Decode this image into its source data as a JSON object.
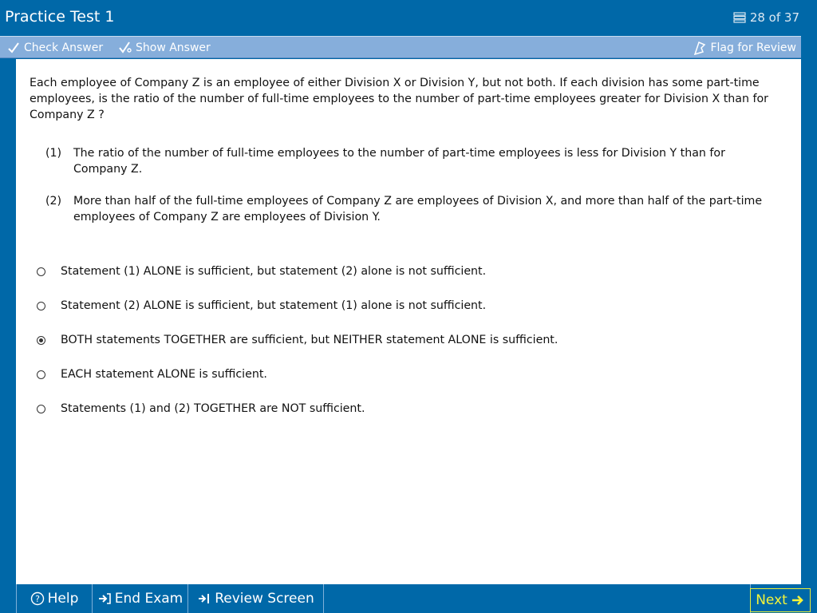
{
  "window": {
    "title": "Practice Test 1",
    "progress": "28 of 37",
    "progress_icon": "stack-icon"
  },
  "toolbar": {
    "check_answer": "Check Answer",
    "show_answer": "Show Answer",
    "flag_for_review": "Flag for Review"
  },
  "question": {
    "stem": "Each employee of Company Z is an employee of either Division X or Division Y, but not both.  If each division has some part-time employees, is the ratio of the number of full-time employees to the number of part-time employees greater for Division X than for Company Z ?",
    "statements": [
      {
        "num": "(1)",
        "text": "The ratio of the number of full-time employees to the number of part-time employees is less for Division Y than for Company Z."
      },
      {
        "num": "(2)",
        "text": "More than half of the full-time employees of Company Z are employees of Division X, and more than half of the part-time employees of Company Z are employees of Division Y."
      }
    ],
    "choices": [
      {
        "text": "Statement (1) ALONE is sufficient, but statement (2) alone is not sufficient.",
        "selected": false
      },
      {
        "text": "Statement (2) ALONE is sufficient, but statement (1) alone is not sufficient.",
        "selected": false
      },
      {
        "text": "BOTH statements TOGETHER are sufficient, but NEITHER statement ALONE is sufficient.",
        "selected": true
      },
      {
        "text": "EACH statement ALONE is sufficient.",
        "selected": false
      },
      {
        "text": "Statements (1) and (2) TOGETHER are NOT sufficient.",
        "selected": false
      }
    ]
  },
  "bottombar": {
    "help": "Help",
    "end_exam": "End Exam",
    "review_screen": "Review Screen",
    "next": "Next"
  },
  "colors": {
    "frame": "#0068a8",
    "toolbar": "#86aedb",
    "next_accent": "#f4f43a"
  }
}
